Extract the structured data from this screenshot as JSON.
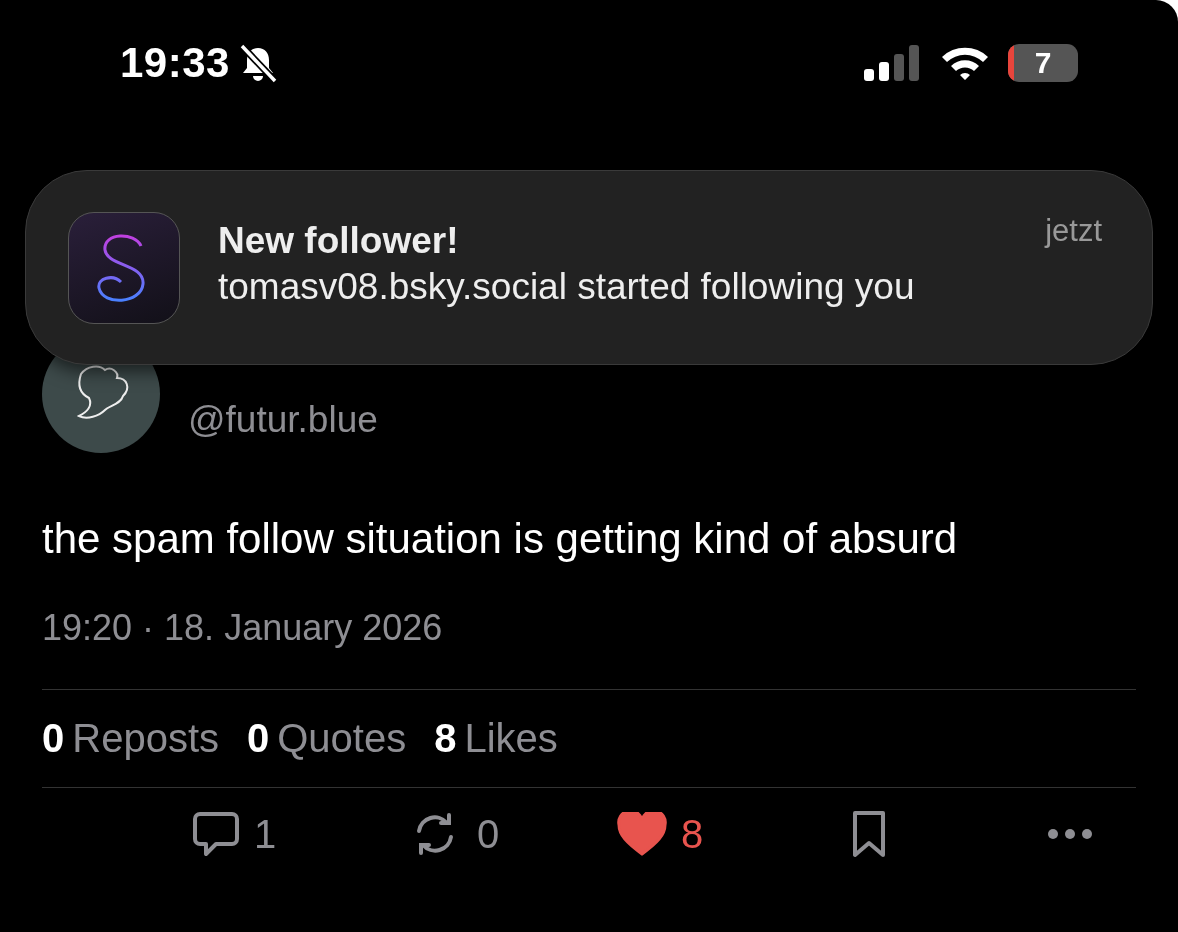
{
  "status_bar": {
    "time": "19:33",
    "silenced": true,
    "battery": "7"
  },
  "notification": {
    "title": "New follower!",
    "body": "tomasv08.bsky.social started following you",
    "time": "jetzt"
  },
  "post": {
    "handle": "@futur.blue",
    "text": "the spam follow situation is getting kind of absurd",
    "timestamp": "19:20 · 18. January 2026",
    "stats": [
      {
        "count": "0",
        "label": "Reposts"
      },
      {
        "count": "0",
        "label": "Quotes"
      },
      {
        "count": "8",
        "label": "Likes"
      }
    ],
    "actions": [
      {
        "kind": "reply",
        "count": "1",
        "active": false
      },
      {
        "kind": "repost",
        "count": "0",
        "active": false
      },
      {
        "kind": "like",
        "count": "8",
        "active": true
      },
      {
        "kind": "bookmark",
        "active": false
      },
      {
        "kind": "more",
        "active": false
      }
    ]
  }
}
